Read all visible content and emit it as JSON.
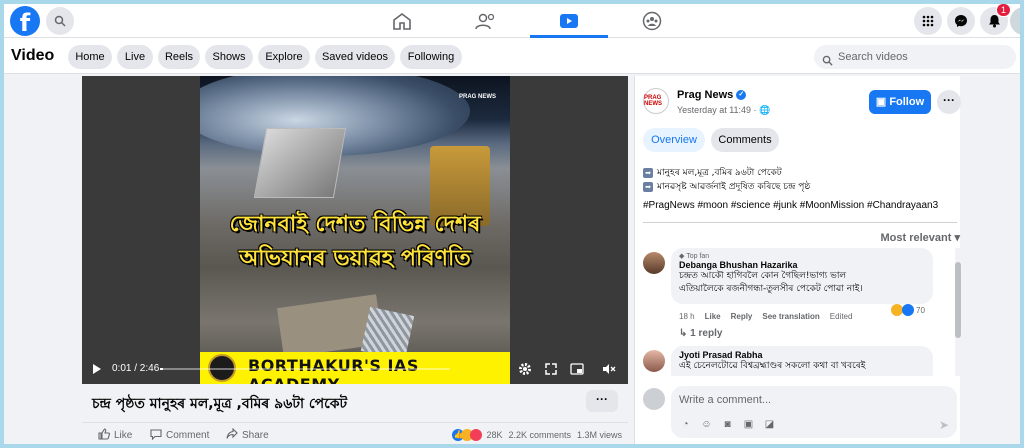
{
  "topbar": {
    "logo": "f",
    "notifications_badge": "1",
    "icons": [
      "search-icon",
      "home-icon",
      "friends-icon",
      "watch-icon",
      "groups-icon",
      "menu-grid-icon",
      "messenger-icon",
      "bell-icon",
      "profile-icon"
    ]
  },
  "video_nav": {
    "title": "Video",
    "pills": [
      "Home",
      "Live",
      "Reels",
      "Shows",
      "Explore",
      "Saved videos",
      "Following"
    ],
    "search_placeholder": "Search videos"
  },
  "player": {
    "headline_line1": "জোনবাই দেশত বিভিন্ন দেশৰ",
    "headline_line2": "অভিযানৰ ভয়াৱহ পৰিণতি",
    "watermark": "PRAG NEWS",
    "banner": "BORTHAKUR'S IAS ACADEMY",
    "timecode": "0:01 / 2:46",
    "progress": 0.01
  },
  "post": {
    "caption": "চন্দ্ৰ পৃষ্ঠত মানুহৰ মল,মূত্ৰ ,বমিৰ ৯৬টা পেকেট",
    "actions": [
      "Like",
      "Comment",
      "Share"
    ],
    "reactions_count": "28K",
    "comments_count": "2.2K comments",
    "views": "1.3M views"
  },
  "panel": {
    "page_name": "Prag News",
    "page_logo": "PRAG NEWS",
    "post_time": "Yesterday at 11:49 ·",
    "follow_label": "Follow",
    "tabs": [
      "Overview",
      "Comments"
    ],
    "desc_lines": [
      "মানুহৰ মল,মূত্ৰ ,বমিৰ ৯৬টা পেকেট",
      "মানৱসৃষ্ট আৱৰ্জনাই প্ৰদূষিত কৰিছে চন্দ্ৰ পৃষ্ঠ"
    ],
    "hashtags": "#PragNews #moon #science #junk #MoonMission #Chandrayaan3",
    "sort_label": "Most relevant",
    "comments": [
      {
        "badge": "Top fan",
        "name": "Debanga Bhushan Hazarika",
        "text_line1": "চন্দ্ৰত আকৌ হাগিবলৈ কোন গৈছিল!ভাগ্য ভাল",
        "text_line2": "এতিয়ালৈকে ৰজনীগন্ধা-তুলসীৰ পেকেট পোৱা নাই।",
        "time": "18 h",
        "like": "Like",
        "reply": "Reply",
        "see_translation": "See translation",
        "edited": "Edited",
        "reaction_count": "70",
        "replies": "1 reply"
      },
      {
        "name": "Jyoti Prasad Rabha",
        "text_line1": "এই চেনেলটোৱে বিশ্বব্ৰহ্মাণ্ডৰ সকলো কথা বা খবৰেই"
      }
    ],
    "composer_placeholder": "Write a comment..."
  },
  "colors": {
    "brand": "#1877f2",
    "banner_yellow": "#fff200",
    "headline_yellow": "#ffe23a"
  }
}
